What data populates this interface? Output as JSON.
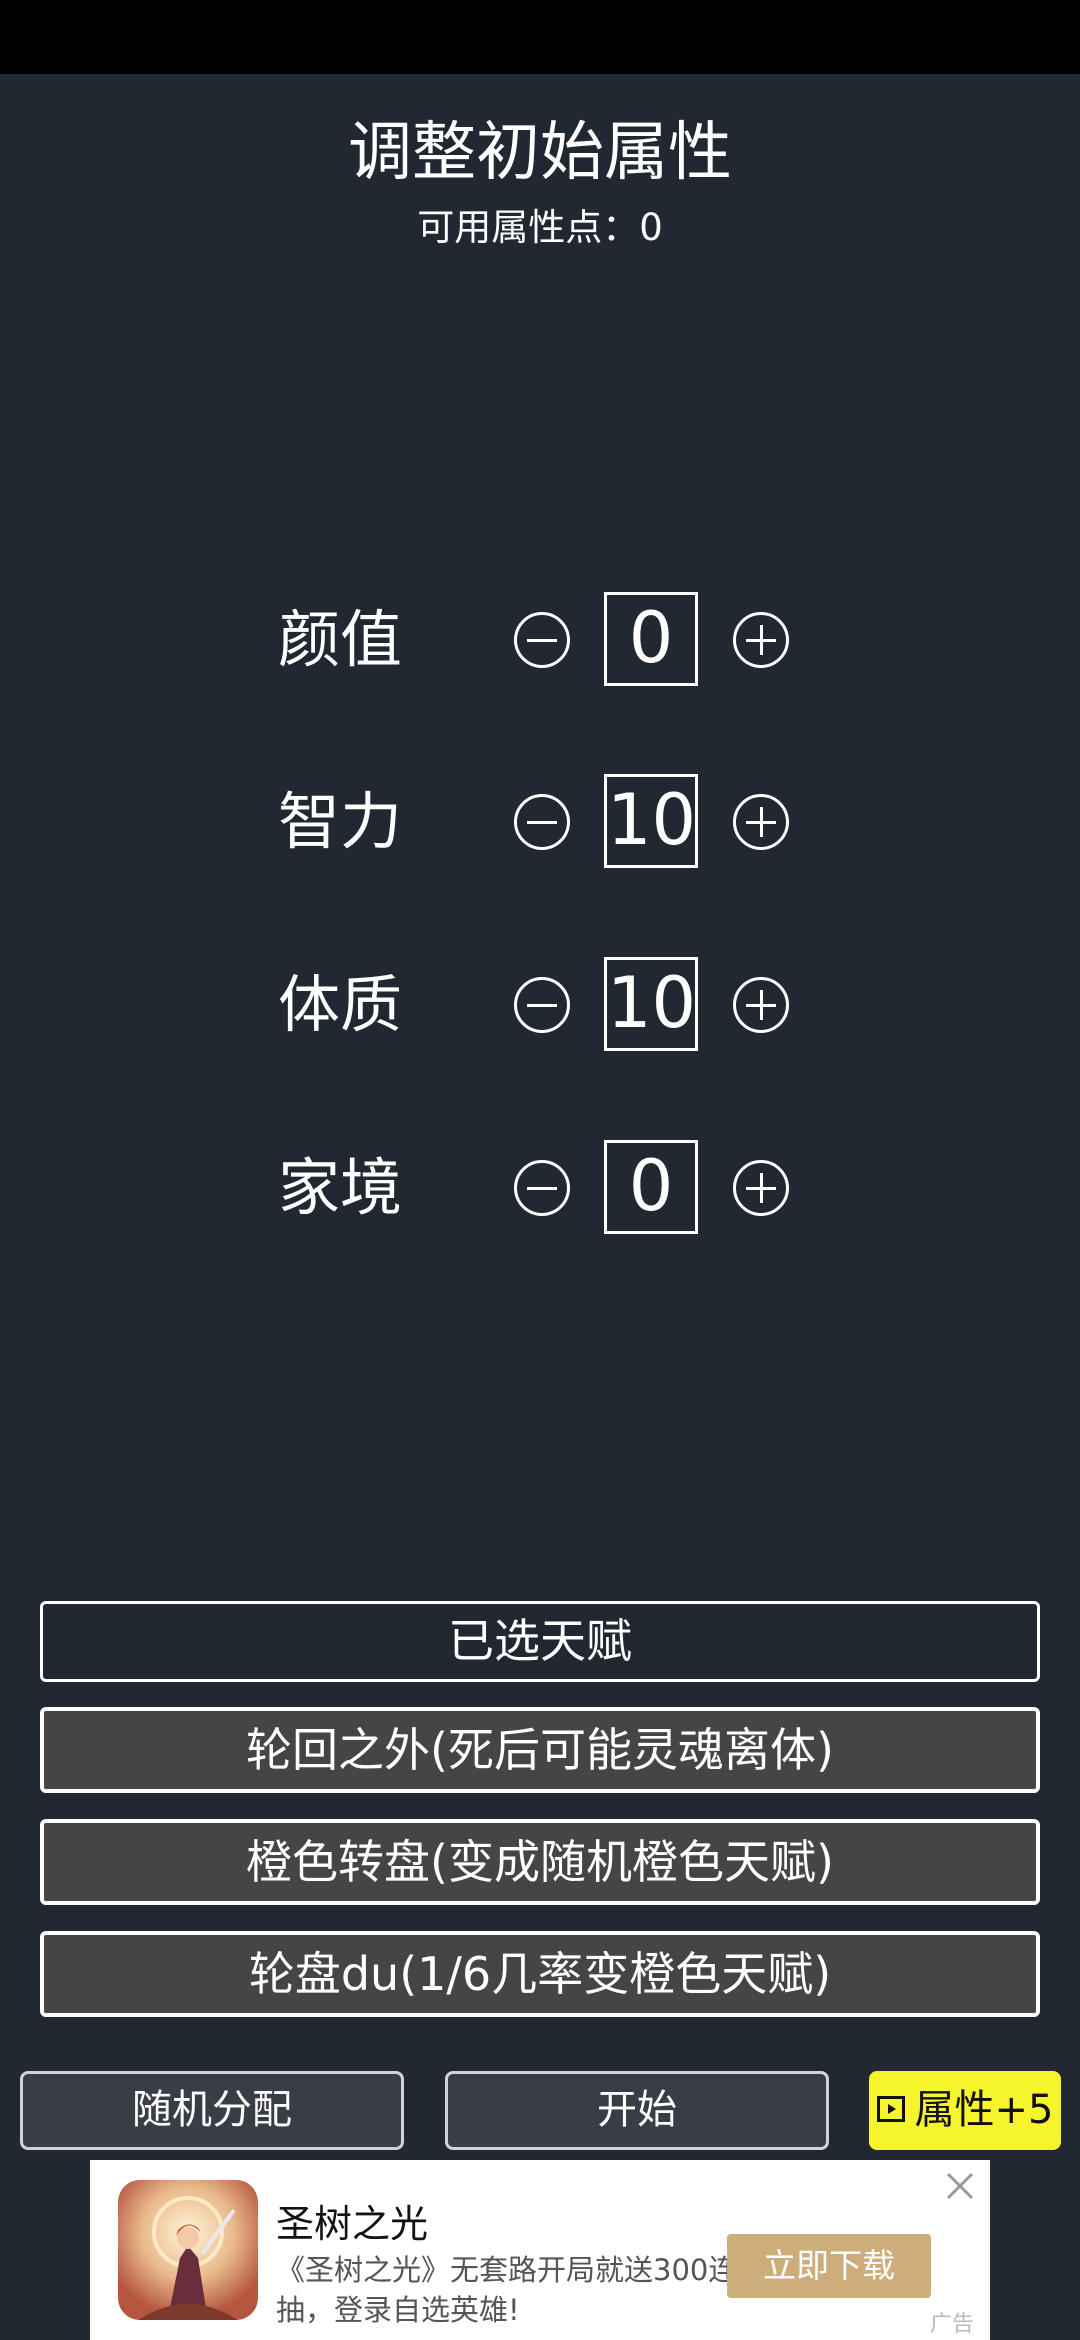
{
  "header": {
    "title": "调整初始属性",
    "points_label": "可用属性点：0"
  },
  "attributes": [
    {
      "label": "颜值",
      "value": "0"
    },
    {
      "label": "智力",
      "value": "10"
    },
    {
      "label": "体质",
      "value": "10"
    },
    {
      "label": "家境",
      "value": "0"
    }
  ],
  "talents": {
    "header": "已选天赋",
    "items": [
      "轮回之外(死后可能灵魂离体)",
      "橙色转盘(变成随机橙色天赋)",
      "轮盘du(1/6几率变橙色天赋)"
    ]
  },
  "actions": {
    "random_label": "随机分配",
    "start_label": "开始",
    "bonus_label": "属性+5",
    "bonus_icon": "video-icon"
  },
  "ad": {
    "title": "圣树之光",
    "description": "《圣树之光》无套路开局就送300连抽，登录自选英雄!",
    "cta": "立即下载",
    "badge": "广告"
  },
  "colors": {
    "background": "#222831",
    "talent_item_bg": "#454545",
    "bonus_bg": "#f6f52c",
    "ad_cta_bg": "#cdae7a"
  }
}
